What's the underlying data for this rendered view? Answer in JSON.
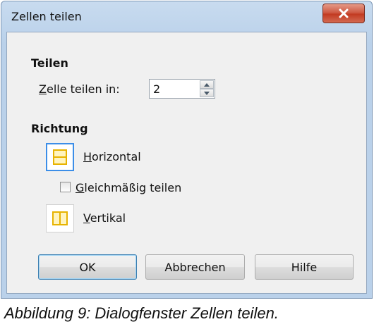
{
  "window": {
    "title": "Zellen teilen",
    "close_icon": "close-icon"
  },
  "split": {
    "section_label": "Teilen",
    "cells_label": "Zelle teilen in:",
    "cells_value": "2"
  },
  "direction": {
    "section_label": "Richtung",
    "horizontal_label": "Horizontal",
    "equal_label": "Gleichmäßig teilen",
    "equal_checked": false,
    "vertical_label": "Vertikal",
    "selected": "Horizontal",
    "icon_color": "#e7b300"
  },
  "buttons": {
    "ok": "OK",
    "cancel": "Abbrechen",
    "help": "Hilfe"
  },
  "caption": "Abbildung 9: Dialogfenster Zellen teilen."
}
